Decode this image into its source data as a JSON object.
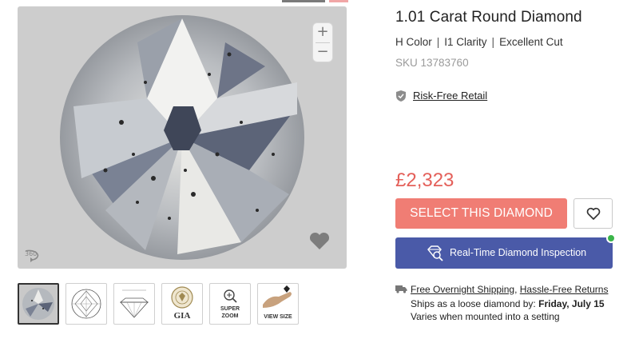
{
  "product": {
    "title": "1.01 Carat Round Diamond",
    "color": "H Color",
    "clarity": "I1 Clarity",
    "cut": "Excellent Cut",
    "sep": "|",
    "sku": "SKU 13783760",
    "risk_free": "Risk-Free Retail",
    "price": "£2,323"
  },
  "actions": {
    "select_label": "SELECT THIS DIAMOND",
    "inspection_label": "Real-Time Diamond Inspection"
  },
  "viewer": {
    "zoom_in": "+",
    "zoom_out": "−",
    "icon_360": "360-icon",
    "thumbnails": [
      {
        "name": "diamond-photo",
        "caption": ""
      },
      {
        "name": "top-diagram",
        "caption": ""
      },
      {
        "name": "side-profile",
        "caption": ""
      },
      {
        "name": "gia",
        "caption": "GIA"
      },
      {
        "name": "super-zoom",
        "caption1": "SUPER",
        "caption2": "ZOOM"
      },
      {
        "name": "view-size",
        "caption": "VIEW SIZE"
      }
    ]
  },
  "shipping": {
    "free_overnight": "Free Overnight Shipping",
    "comma": ",",
    "returns": "Hassle-Free Returns",
    "ships_prefix": "Ships as a loose diamond by:",
    "ships_date": "Friday, July 15",
    "varies": "Varies when mounted into a setting"
  },
  "colors": {
    "price": "#e4605a",
    "select_button": "#f07d74",
    "inspection_button": "#4a5aa8",
    "online": "#3bb54a"
  }
}
